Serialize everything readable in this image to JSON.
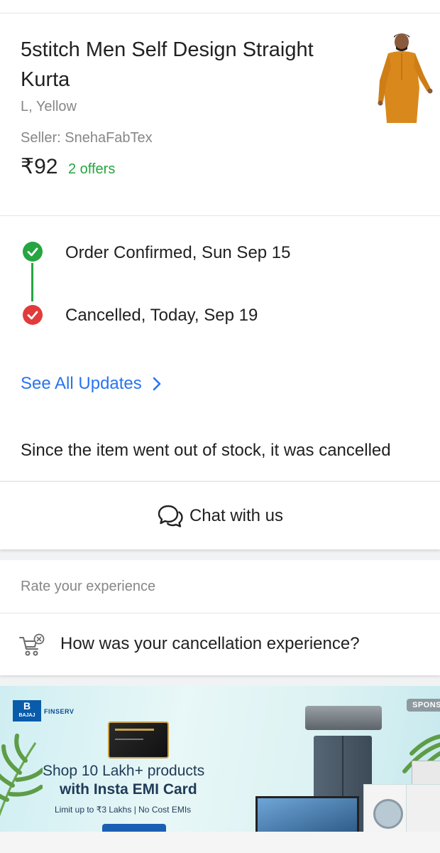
{
  "product": {
    "title": "5stitch Men Self Design Straight Kurta",
    "variant": "L, Yellow",
    "seller": "Seller: SnehaFabTex",
    "price": "₹92",
    "offers": "2 offers"
  },
  "timeline": [
    {
      "text": "Order Confirmed, Sun Sep 15",
      "status": "done",
      "color": "#26a541"
    },
    {
      "text": "Cancelled, Today, Sep 19",
      "status": "cancelled",
      "color": "#e23b3b"
    }
  ],
  "see_all_updates": "See All Updates",
  "cancellation_message": "Since the item went out of stock, it was cancelled",
  "chat_label": "Chat with us",
  "rating": {
    "heading": "Rate your experience",
    "question": "How was your cancellation experience?"
  },
  "banner": {
    "brand": "BAJAJ",
    "brand_sub": "FINSERV",
    "sponsored": "SPONS",
    "line1": "Shop 10 Lakh+ products",
    "line2": "with Insta EMI Card",
    "line3": "Limit up to ₹3 Lakhs | No Cost EMIs"
  },
  "colors": {
    "accent_blue": "#2874f0",
    "success_green": "#26a541",
    "error_red": "#e23b3b",
    "muted_text": "#878787"
  }
}
